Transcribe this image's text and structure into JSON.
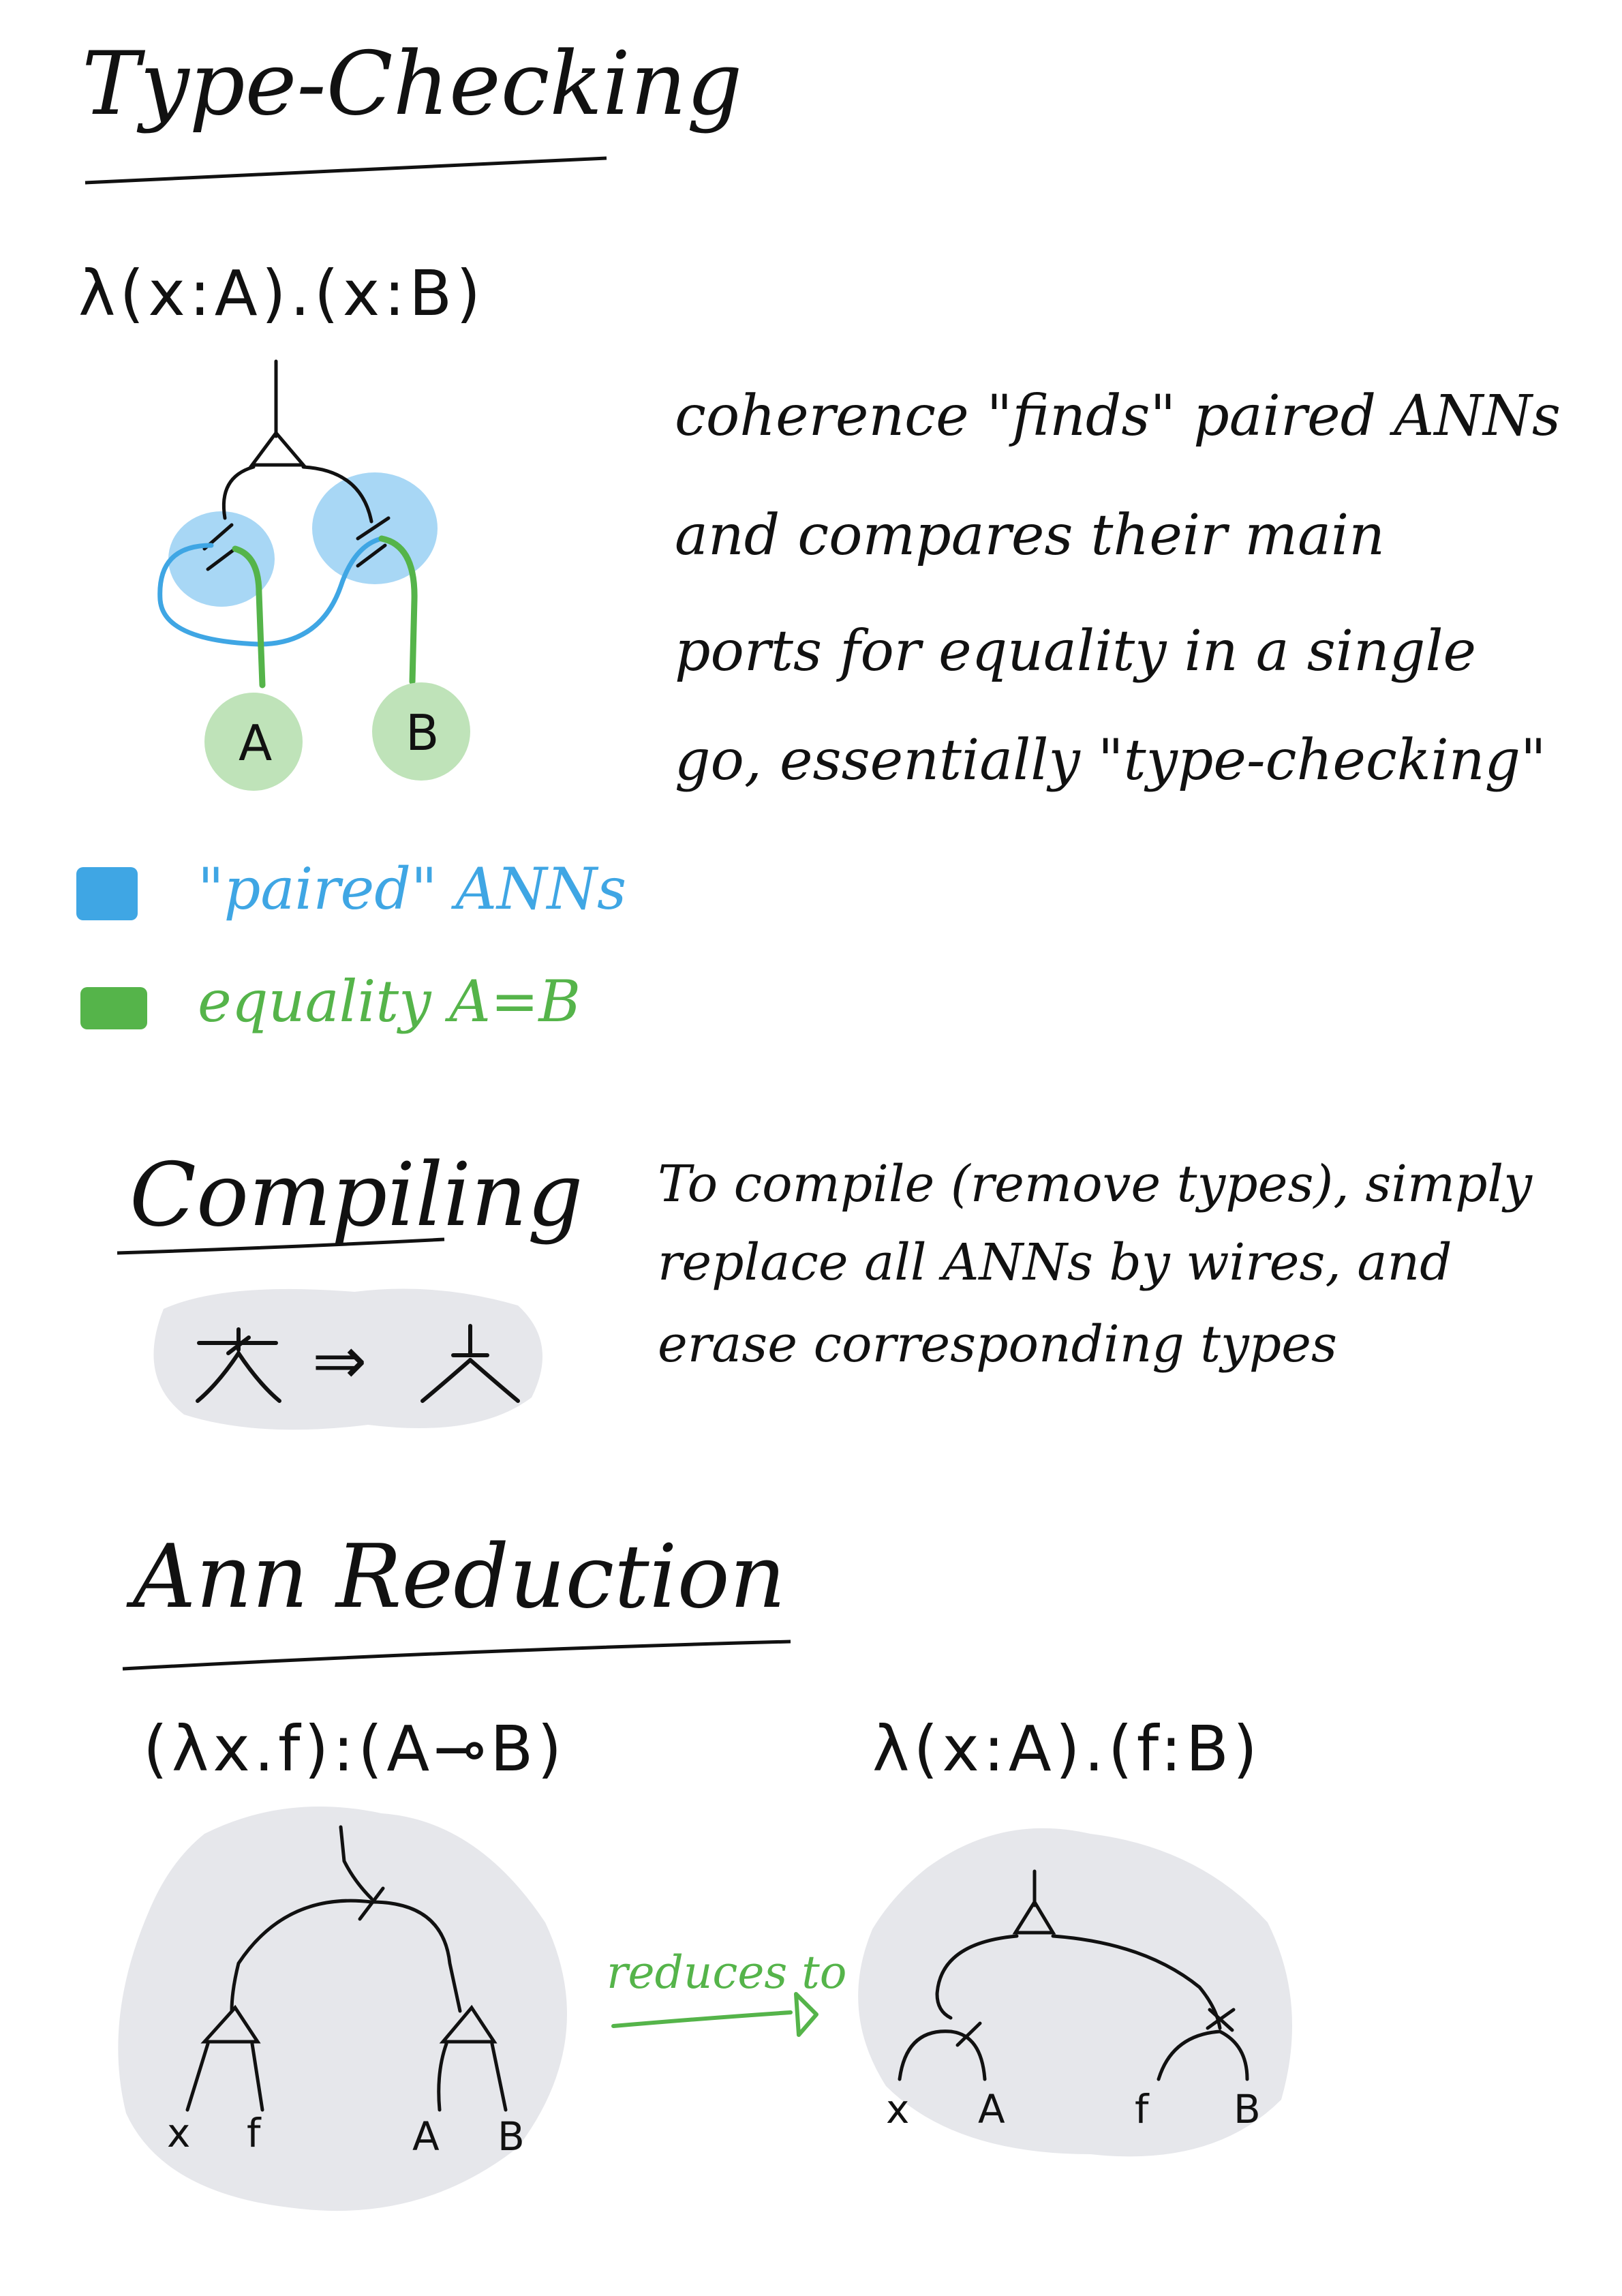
{
  "sections": {
    "type_checking": {
      "title": "Type-Checking",
      "formula": "λ(x:A).(x:B)",
      "leaf_a": "A",
      "leaf_b": "B",
      "description_lines": [
        "coherence \"finds\" paired ANNs",
        "and compares their main",
        "ports for equality in a single",
        "go, essentially \"type-checking\""
      ],
      "legend": [
        {
          "label": "\"paired\" ANNs",
          "color": "#3fa6e4"
        },
        {
          "label": "equality A=B",
          "color": "#55b44a"
        }
      ]
    },
    "compiling": {
      "title": "Compiling",
      "arrow": "⇒",
      "description_lines": [
        "To compile (remove types), simply",
        "replace all ANNs by wires, and",
        "erase corresponding types"
      ]
    },
    "ann_reduction": {
      "title": "Ann Reduction",
      "left_formula": "(λx.f):(A⊸B)",
      "right_formula": "λ(x:A).(f:B)",
      "arrow_label": "reduces to",
      "left_leaves": [
        "x",
        "f",
        "A",
        "B"
      ],
      "right_leaves": [
        "x",
        "A",
        "f",
        "B"
      ]
    }
  },
  "colors": {
    "ink": "#111111",
    "blue_highlight": "#a8d7f5",
    "blue_wire": "#3fa6e4",
    "green_highlight": "#bfe3b9",
    "green_wire": "#55b44a",
    "gray_blob": "#e6e7eb"
  }
}
